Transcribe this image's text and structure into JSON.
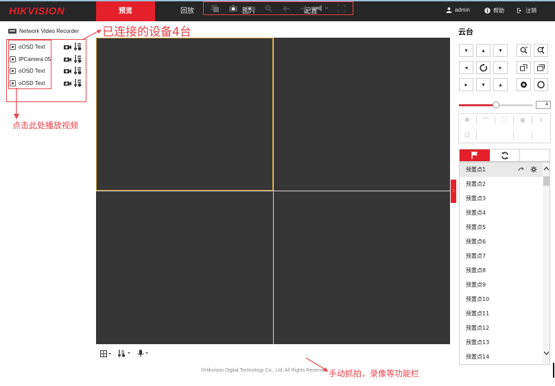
{
  "brand": {
    "logo": "HIKVISION"
  },
  "nav": {
    "tabs": [
      "预览",
      "回放",
      "图片",
      "配置"
    ],
    "active_tab": "预览"
  },
  "user": {
    "name": "admin",
    "help": "帮助",
    "logout": "注销"
  },
  "device_tree": {
    "root": "Network Video Recorder",
    "cameras": [
      {
        "label": "oOSD Text"
      },
      {
        "label": "IPCamera 05"
      },
      {
        "label": "oOSD Text"
      },
      {
        "label": "oOSD Text"
      }
    ]
  },
  "annotations": {
    "connected_devices": "已连接的设备4台",
    "click_to_play": "点击此处播放视频",
    "toolbar_note": "手动抓拍，录像等功能栏"
  },
  "ptz": {
    "title": "云台",
    "speed_value": "4",
    "speed_fraction": 0.5,
    "presets": [
      "预置点1",
      "预置点2",
      "预置点3",
      "预置点4",
      "预置点5",
      "预置点6",
      "预置点7",
      "预置点8",
      "预置点9",
      "预置点10",
      "预置点11",
      "预置点12",
      "预置点13",
      "预置点14"
    ]
  },
  "footer": {
    "copyright": "©Hikvision Digital Technology Co., Ltd. All Rights Reserved."
  },
  "colors": {
    "brand_red": "#e4202a",
    "annotation_red": "#e8434b",
    "selected_border": "#c89b34",
    "pane_bg": "#363636"
  },
  "icons": {
    "toolbar_left": [
      "window-layout-icon",
      "playback-icon",
      "microphone-icon"
    ],
    "toolbar_right": [
      "stop-all-icon",
      "capture-icon",
      "record-icon",
      "digital-zoom-icon",
      "previous-page-icon",
      "next-page-icon",
      "volume-icon",
      "fullscreen-icon"
    ]
  }
}
